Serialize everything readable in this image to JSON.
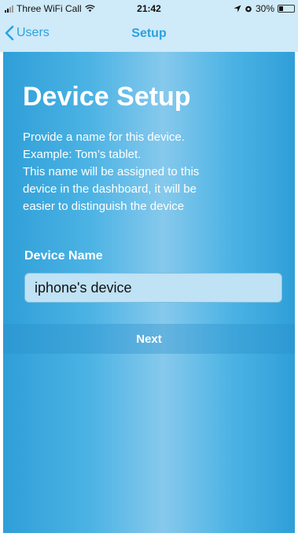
{
  "status_bar": {
    "carrier": "Three WiFi Call",
    "time": "21:42",
    "battery": "30%",
    "battery_level": 0.3,
    "icons": [
      "signal-icon",
      "wifi-icon",
      "location-icon",
      "alarm-icon",
      "battery-icon"
    ]
  },
  "nav": {
    "back_label": "Users",
    "title": "Setup"
  },
  "main": {
    "title": "Device Setup",
    "description": [
      "Provide a name for this device.",
      "Example: Tom’s tablet.",
      "This name will be assigned to this",
      "device in the dashboard, it will be",
      "easier to distinguish the device"
    ],
    "field_label": "Device Name",
    "device_name_value": "iphone's device",
    "next_label": "Next"
  },
  "colors": {
    "accent": "#2aa2e0",
    "bar_background": "#cfeaf8",
    "content_gradient_edge": "#2f9fd8",
    "content_gradient_center": "#86c9ec"
  }
}
